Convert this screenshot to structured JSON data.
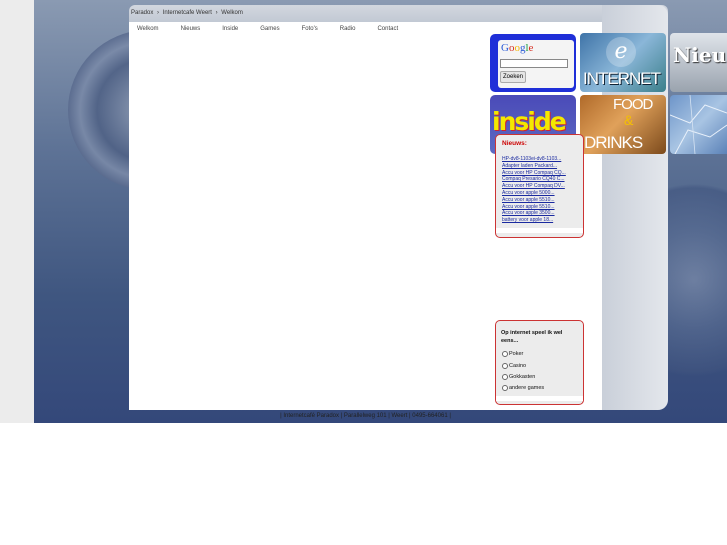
{
  "breadcrumb": [
    "Paradox",
    "Internetcafe Weert",
    "Welkom"
  ],
  "breadcrumb_separator": "›",
  "nav": [
    "Welkom",
    "Nieuws",
    "Inside",
    "Games",
    "Foto's",
    "Radio",
    "Contact"
  ],
  "google": {
    "logo": "Google",
    "button_label": "Zoeken",
    "input_value": ""
  },
  "tiles": {
    "internet": "INTERNET",
    "news": "Nieu",
    "inside": "inside",
    "food": "FOOD",
    "amp": "&",
    "drinks": "DRINKS"
  },
  "news_box": {
    "title": "Nieuws:",
    "items": [
      "HP-dv8-1103ei-dv8-1103...",
      "Adapter laden Packard...",
      "Accu voor HP Compaq CQ...",
      "Compaq Presario CQ40 C...",
      "Accu voor HP Compaq DV...",
      "Accu voor apple 5000...",
      "Accu voor apple 5510...",
      "Accu voor apple 5510...",
      "Accu voor apple 3500...",
      "battery voor apple 18..."
    ]
  },
  "poll": {
    "question": "Op internet speel ik wel eens...",
    "options": [
      "Poker",
      "Casino",
      "Gokkasten",
      "andere games"
    ]
  },
  "footer": "| Internetcafé Paradox | Parallelweg 101 | Weert | 0495-664061 |",
  "colors": {
    "accent_red": "#cc3333",
    "link_blue": "#1a2aa0",
    "google_blue": "#1f2fd8"
  }
}
